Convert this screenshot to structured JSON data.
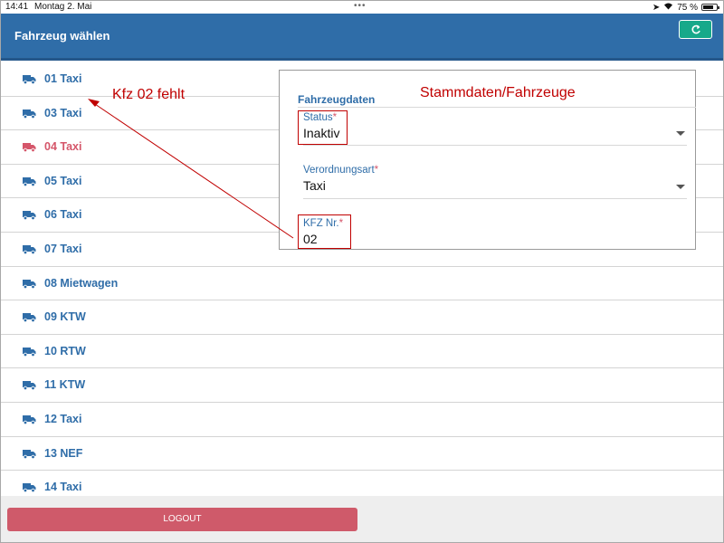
{
  "statusbar": {
    "time": "14:41",
    "date": "Montag 2. Mai",
    "battery": "75 %"
  },
  "header": {
    "title": "Fahrzeug wählen",
    "refresh_icon": "refresh-icon"
  },
  "vehicles": [
    {
      "label": "01 Taxi",
      "status": "active"
    },
    {
      "label": "03 Taxi",
      "status": "active"
    },
    {
      "label": "04 Taxi",
      "status": "inactive"
    },
    {
      "label": "05 Taxi",
      "status": "active"
    },
    {
      "label": "06 Taxi",
      "status": "active"
    },
    {
      "label": "07 Taxi",
      "status": "active"
    },
    {
      "label": "08 Mietwagen",
      "status": "active"
    },
    {
      "label": "09 KTW",
      "status": "active"
    },
    {
      "label": "10 RTW",
      "status": "active"
    },
    {
      "label": "11 KTW",
      "status": "active"
    },
    {
      "label": "12 Taxi",
      "status": "active"
    },
    {
      "label": "13 NEF",
      "status": "active"
    },
    {
      "label": "14 Taxi",
      "status": "active"
    }
  ],
  "logout_label": "LOGOUT",
  "colors": {
    "primary": "#2f6da8",
    "inactive": "#d5566a",
    "accent": "#17a98a",
    "annotation": "#c00000"
  },
  "annotation": {
    "missing_note": "Kfz 02 fehlt",
    "overlay_title": "Stammdaten/Fahrzeuge"
  },
  "panel": {
    "title": "Fahrzeugdaten",
    "status": {
      "label": "Status",
      "required": "*",
      "value": "Inaktiv"
    },
    "verordnungsart": {
      "label": "Verordnungsart",
      "required": "*",
      "value": "Taxi"
    },
    "kfz": {
      "label": "KFZ Nr.",
      "required": "*",
      "value": "02"
    }
  }
}
